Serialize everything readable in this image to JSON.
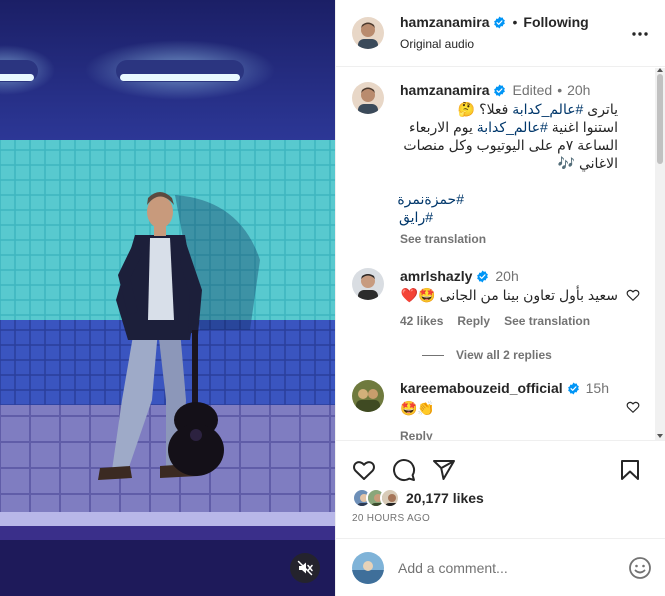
{
  "post": {
    "author": "hamzanamira",
    "follow_dot": "•",
    "follow_label": "Following",
    "audio_label": "Original audio"
  },
  "caption": {
    "username": "hamzanamira",
    "edited_label": "Edited",
    "dot": "•",
    "time": "20h",
    "lines": [
      {
        "pre": "ياترى ",
        "tag": "#عالم_كدابة",
        "post": " فعلا؟ 🤔"
      },
      {
        "pre": "استنوا اغنية ",
        "tag": "#عالم_كدابة",
        "post": " يوم الاربعاء"
      },
      {
        "pre": "الساعة ٧م على اليوتيوب وكل منصات",
        "tag": "",
        "post": ""
      },
      {
        "pre": "الاغاني 🎶",
        "tag": "",
        "post": ""
      }
    ],
    "hashtags": [
      "#حمزةنمرة",
      "#رايق"
    ],
    "see_translation": "See translation"
  },
  "comments": [
    {
      "username": "amrlshazly",
      "time": "20h",
      "text": "سعيد بأول تعاون بينا من الجانى 🤩❤️",
      "likes": "42 likes",
      "reply": "Reply",
      "see_translation": "See translation",
      "view_replies": "View all 2 replies"
    },
    {
      "username": "kareemabouzeid_official",
      "time": "15h",
      "text": "🤩👏",
      "reply": "Reply"
    }
  ],
  "engagement": {
    "likes_count": "20,177 likes",
    "time_ago": "20 HOURS AGO"
  },
  "add_comment": {
    "placeholder": "Add a comment..."
  },
  "icons": {
    "more": "more-horizontal-icon",
    "heart": "heart-icon",
    "comment": "comment-icon",
    "share": "share-icon",
    "save": "bookmark-icon",
    "mute": "muted-speaker-icon",
    "emoji": "emoji-icon"
  },
  "colors": {
    "verified": "#0095f6",
    "hashtag": "#00376b",
    "muted_text": "#737373",
    "heart_red": "#ed4956"
  }
}
